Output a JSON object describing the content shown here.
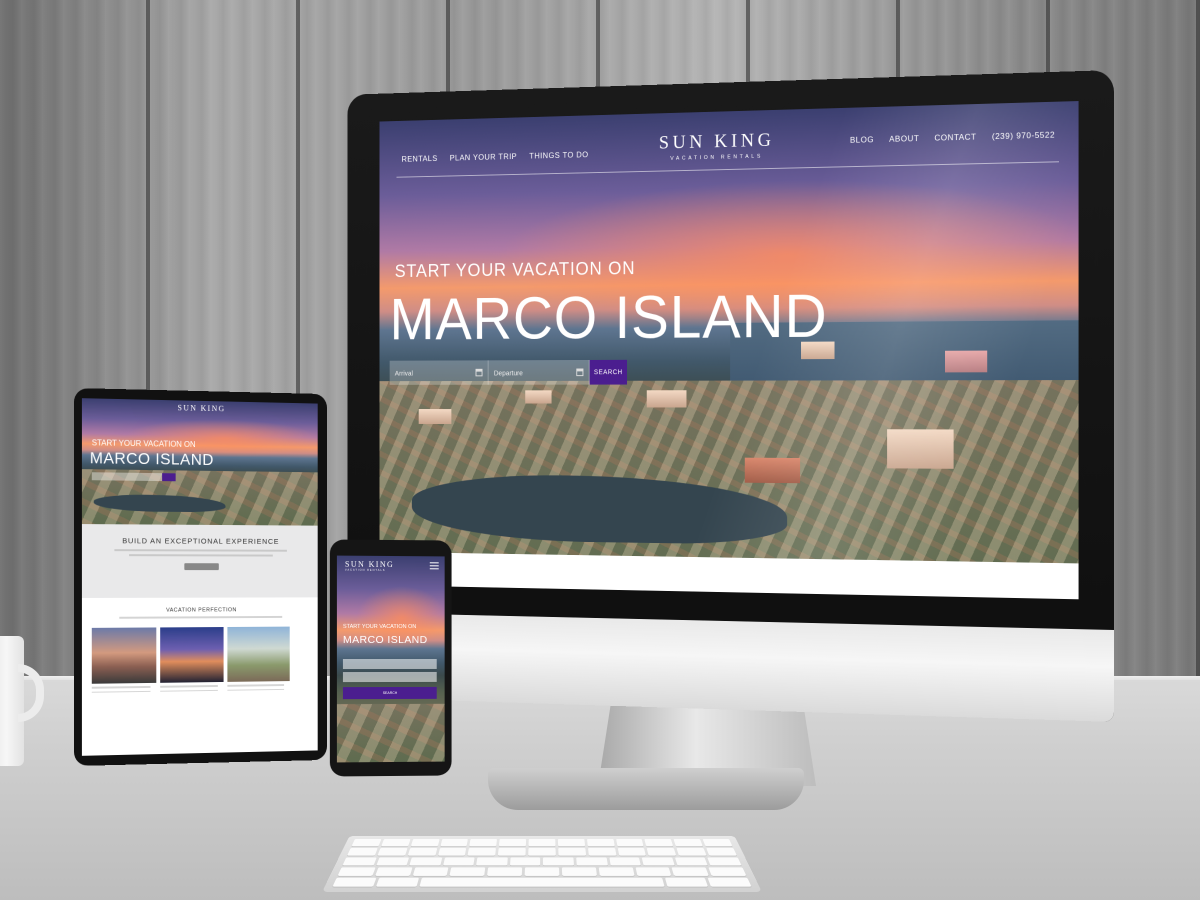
{
  "desktop": {
    "nav_left": [
      "RENTALS",
      "PLAN YOUR TRIP",
      "THINGS TO DO"
    ],
    "logo_main": "SUN KING",
    "logo_sub": "VACATION RENTALS",
    "nav_right": [
      "BLOG",
      "ABOUT",
      "CONTACT",
      "(239) 970-5522"
    ],
    "eyebrow": "START YOUR VACATION ON",
    "headline": "MARCO ISLAND",
    "search": {
      "arrival_placeholder": "Arrival",
      "departure_placeholder": "Departure",
      "button_label": "SEARCH",
      "button_color": "#4b1e8f"
    }
  },
  "tablet": {
    "logo_main": "SUN KING",
    "eyebrow": "START YOUR VACATION ON",
    "headline": "MARCO ISLAND",
    "section_title": "BUILD AN EXCEPTIONAL EXPERIENCE",
    "section2_title": "VACATION PERFECTION"
  },
  "phone": {
    "logo_main": "SUN KING",
    "logo_sub": "VACATION RENTALS",
    "eyebrow": "START YOUR VACATION ON",
    "headline": "MARCO ISLAND",
    "search_button": "SEARCH"
  },
  "icons": [
    "calendar-icon",
    "hamburger-menu-icon"
  ]
}
